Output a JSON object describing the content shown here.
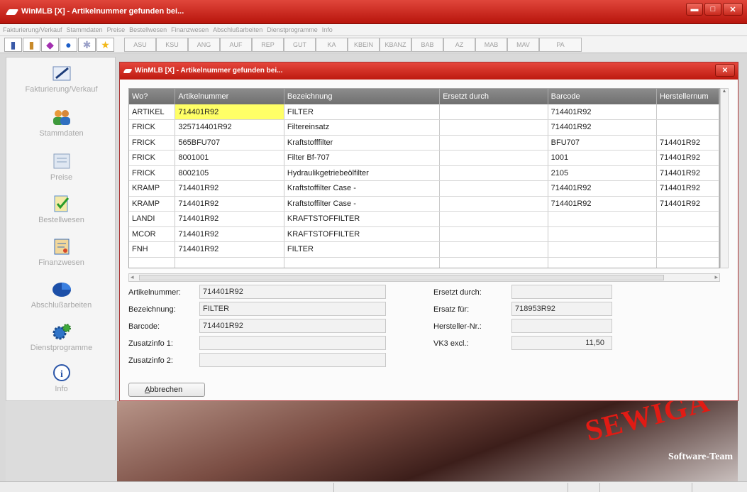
{
  "window": {
    "title": "WinMLB [X] - Artikelnummer gefunden bei..."
  },
  "menu": [
    "Fakturierung/Verkauf",
    "Stammdaten",
    "Preise",
    "Bestellwesen",
    "Finanzwesen",
    "Abschlußarbeiten",
    "Dienstprogramme",
    "Info"
  ],
  "toolbar": {
    "buttons": [
      "ASU",
      "KSU",
      "ANG",
      "AUF",
      "REP",
      "GUT",
      "KA",
      "KBEIN",
      "KBANZ",
      "BAB",
      "AZ",
      "MAB",
      "MAV",
      "PA"
    ]
  },
  "sidebar": {
    "items": [
      {
        "label": "Fakturierung/Verkauf",
        "icon": "pen-icon"
      },
      {
        "label": "Stammdaten",
        "icon": "users-icon"
      },
      {
        "label": "Preise",
        "icon": "pricelist-icon"
      },
      {
        "label": "Bestellwesen",
        "icon": "checklist-icon"
      },
      {
        "label": "Finanzwesen",
        "icon": "notes-icon"
      },
      {
        "label": "Abschlußarbeiten",
        "icon": "pie-icon"
      },
      {
        "label": "Dienstprogramme",
        "icon": "gears-icon"
      },
      {
        "label": "Info",
        "icon": "info-icon"
      }
    ]
  },
  "dialog": {
    "title": "WinMLB [X] - Artikelnummer gefunden bei...",
    "columns": [
      "Wo?",
      "Artikelnummer",
      "Bezeichnung",
      "Ersetzt durch",
      "Barcode",
      "Herstellernum"
    ],
    "rows": [
      [
        "ARTIKEL",
        "714401R92",
        "FILTER",
        "",
        "714401R92",
        ""
      ],
      [
        "FRICK",
        "325714401R92",
        "Filtereinsatz",
        "",
        "714401R92",
        ""
      ],
      [
        "FRICK",
        "565BFU707",
        "Kraftstofffilter",
        "",
        "BFU707",
        "714401R92"
      ],
      [
        "FRICK",
        "8001001",
        "Filter Bf-707",
        "",
        "1001",
        "714401R92"
      ],
      [
        "FRICK",
        "8002105",
        "Hydraulikgetriebeölfilter",
        "",
        "2105",
        "714401R92"
      ],
      [
        "KRAMP",
        "714401R92",
        "Kraftstoffilter Case -",
        "",
        "714401R92",
        "714401R92"
      ],
      [
        "KRAMP",
        "714401R92",
        "Kraftstoffilter Case -",
        "",
        "714401R92",
        "714401R92"
      ],
      [
        "LANDI",
        "714401R92",
        "KRAFTSTOFFILTER",
        "",
        "",
        ""
      ],
      [
        "MCOR",
        "714401R92",
        "KRAFTSTOFFILTER",
        "",
        "",
        ""
      ],
      [
        "FNH",
        "714401R92",
        "FILTER",
        "",
        "",
        ""
      ],
      [
        "",
        "",
        "",
        "",
        "",
        ""
      ]
    ],
    "fields": {
      "artikelnummer_label": "Artikelnummer:",
      "artikelnummer_value": "714401R92",
      "bezeichnung_label": "Bezeichnung:",
      "bezeichnung_value": "FILTER",
      "barcode_label": "Barcode:",
      "barcode_value": "714401R92",
      "zusatzinfo1_label": "Zusatzinfo 1:",
      "zusatzinfo1_value": "",
      "zusatzinfo2_label": "Zusatzinfo 2:",
      "zusatzinfo2_value": "",
      "ersetzt_label": "Ersetzt durch:",
      "ersetzt_value": "",
      "ersatz_fuer_label": "Ersatz für:",
      "ersatz_fuer_value": "718953R92",
      "hersteller_label": "Hersteller-Nr.:",
      "hersteller_value": "",
      "vk3_label": "VK3 excl.:",
      "vk3_value": "11,50"
    },
    "cancel_button": {
      "accel": "A",
      "rest": "bbrechen"
    }
  },
  "logo": {
    "brand": "SEWIGA",
    "subtitle": "Software-Team"
  },
  "colors": {
    "titlebar": "#c9271c",
    "highlight": "#ffff66",
    "grid_header": "#7d7d7d"
  }
}
